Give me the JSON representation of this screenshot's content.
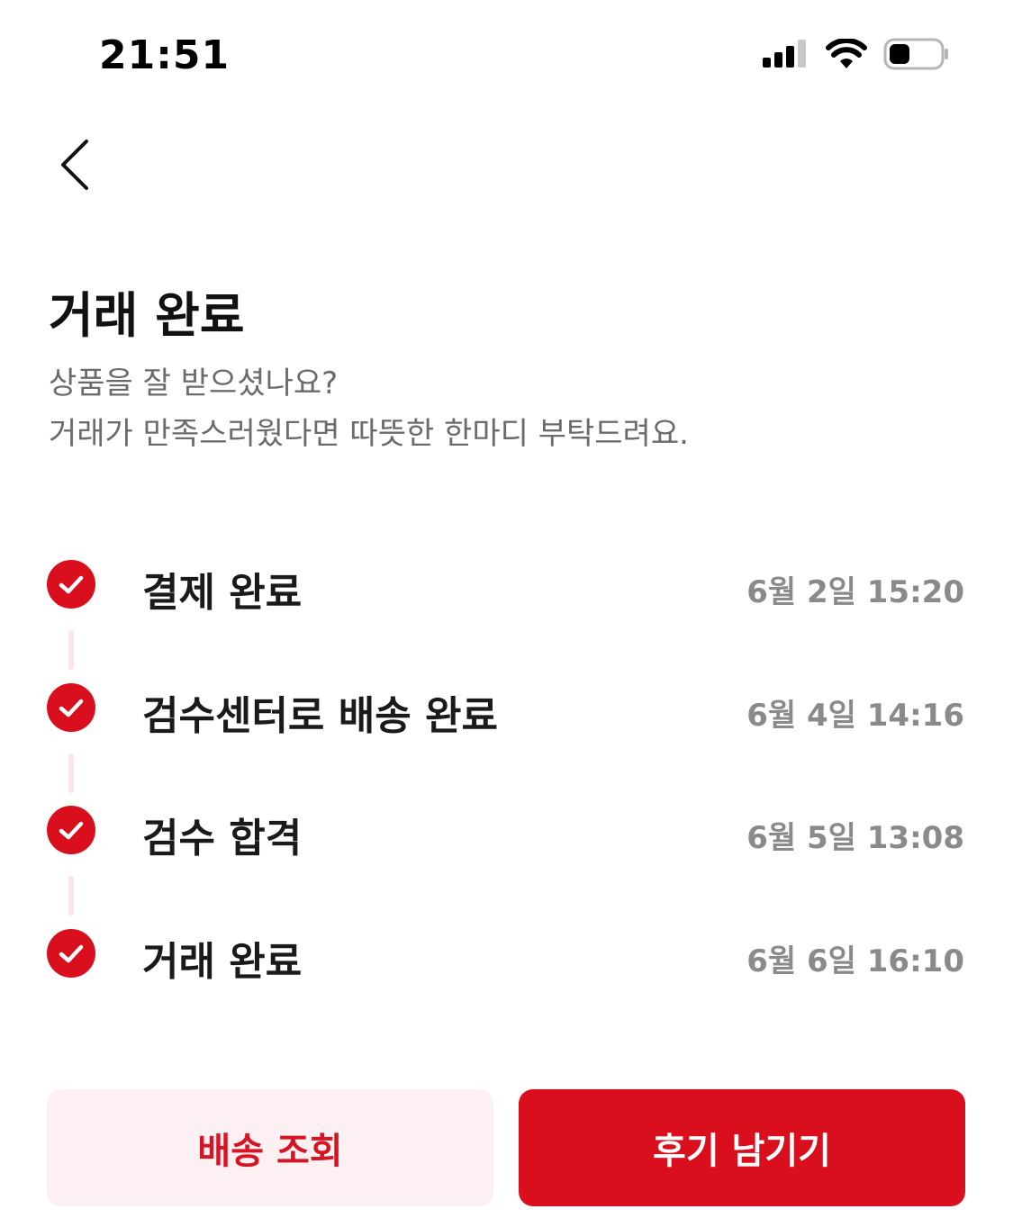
{
  "status_bar": {
    "time": "21:51",
    "icons": [
      "cellular-signal-icon",
      "wifi-icon",
      "battery-icon"
    ]
  },
  "header": {
    "back_icon": "chevron-left-icon",
    "title": "거래 완료",
    "subtitle_line1": "상품을 잘 받으셨나요?",
    "subtitle_line2": "거래가 만족스러웠다면 따뜻한 한마디 부탁드려요."
  },
  "timeline": {
    "steps": [
      {
        "label": "결제 완료",
        "time": "6월 2일 15:20",
        "status": "done"
      },
      {
        "label": "검수센터로 배송 완료",
        "time": "6월 4일 14:16",
        "status": "done"
      },
      {
        "label": "검수 합격",
        "time": "6월 5일 13:08",
        "status": "done"
      },
      {
        "label": "거래 완료",
        "time": "6월 6일 16:10",
        "status": "done"
      }
    ]
  },
  "actions": {
    "track_delivery_label": "배송 조회",
    "write_review_label": "후기 남기기"
  },
  "colors": {
    "accent": "#d90f1e",
    "accent_light": "#fdf0f2",
    "connector": "#fde4e6",
    "muted_text": "#6b6b6b",
    "time_text": "#8a8a8a"
  }
}
